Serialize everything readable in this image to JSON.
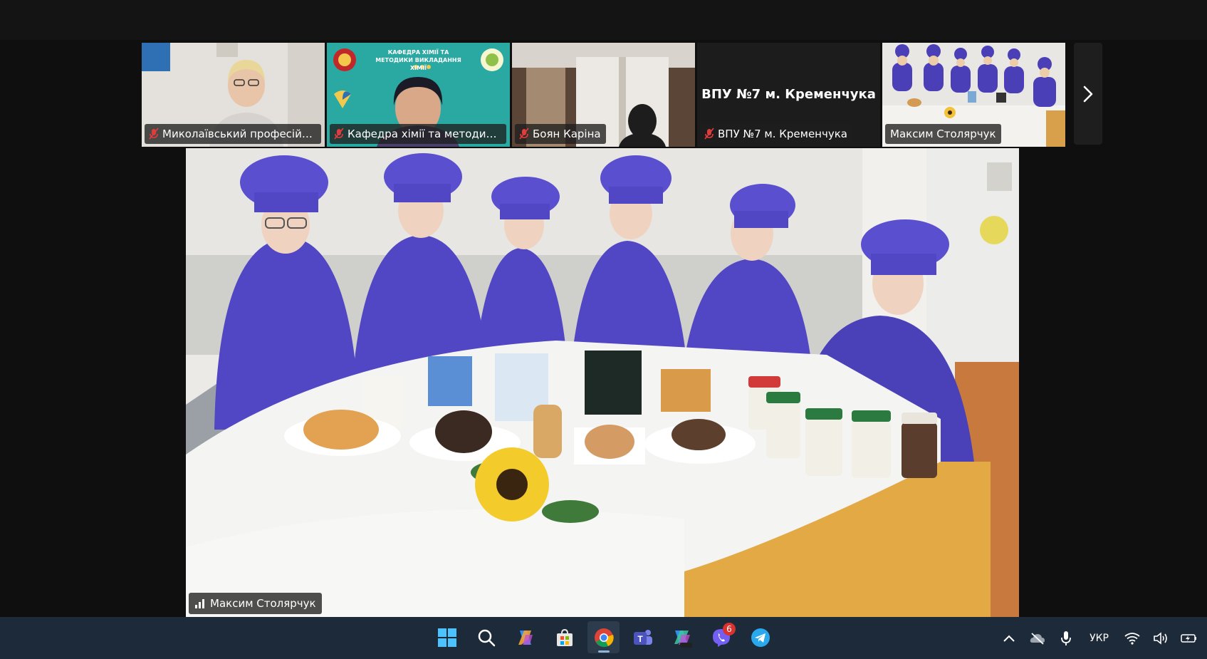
{
  "participants": [
    {
      "name": "Миколаївський професійний ...",
      "muted": true
    },
    {
      "name": "Кафедра хімії та методики вик...",
      "muted": true,
      "banner_title": "КАФЕДРА ХІМІЇ ТА МЕТОДИКИ ВИКЛАДАННЯ ХІМІЇ"
    },
    {
      "name": "Боян Каріна",
      "muted": true
    },
    {
      "name": "ВПУ №7 м. Кременчука",
      "muted": true,
      "title": "ВПУ №7 м. Кременчука"
    },
    {
      "name": "Максим Столярчук",
      "muted": false,
      "active": true
    }
  ],
  "main_speaker": {
    "name": "Максим Столярчук"
  },
  "taskbar": {
    "apps": [
      {
        "icon": "windows-start-icon"
      },
      {
        "icon": "search-icon"
      },
      {
        "icon": "copilot-icon"
      },
      {
        "icon": "store-icon"
      },
      {
        "icon": "chrome-icon",
        "active": true
      },
      {
        "icon": "teams-icon"
      },
      {
        "icon": "m365-copilot-icon"
      },
      {
        "icon": "viber-icon",
        "badge": "6"
      },
      {
        "icon": "telegram-icon"
      }
    ],
    "tray": {
      "language": "УКР"
    }
  },
  "colors": {
    "active_tile_border": "#c8e35a",
    "taskbar": "#1c2a3a",
    "chef_uniform": "#5146c4"
  }
}
